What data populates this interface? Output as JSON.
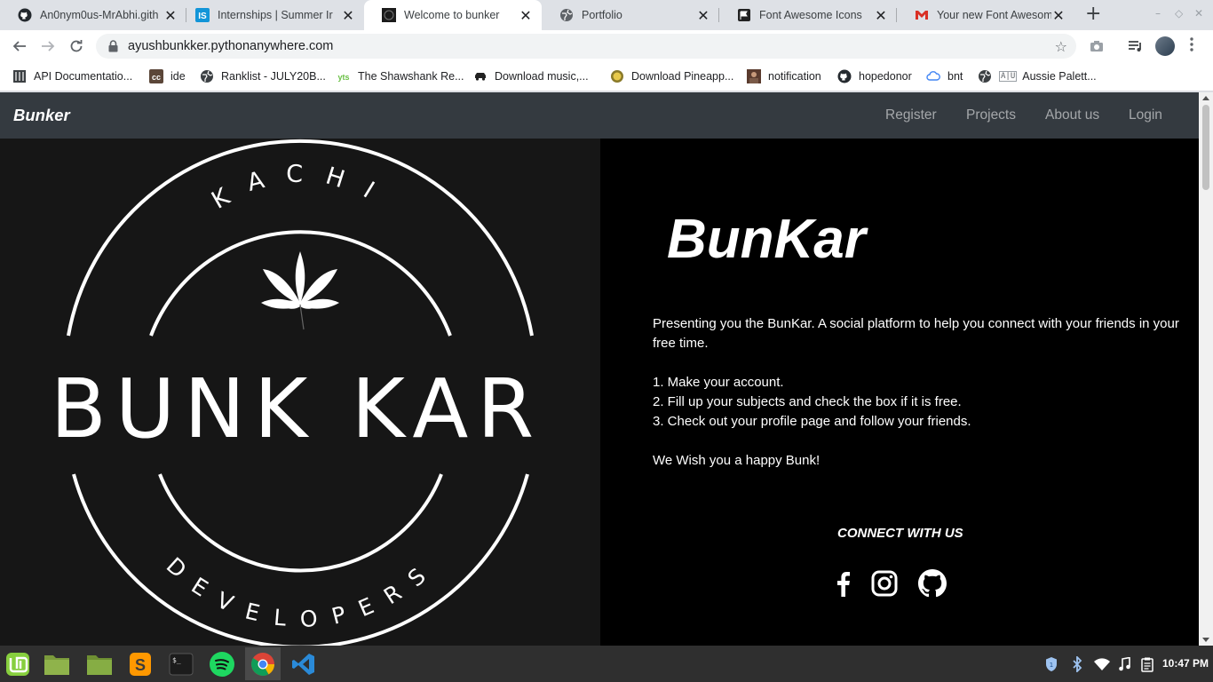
{
  "browser": {
    "tabs": [
      {
        "title": "An0nym0us-MrAbhi.gith",
        "favicon": "github-icon"
      },
      {
        "title": "Internships | Summer Ir",
        "favicon": "internshala-icon"
      },
      {
        "title": "Welcome to bunker",
        "favicon": "bunker-icon",
        "active": true
      },
      {
        "title": "Portfolio",
        "favicon": "globe-icon"
      },
      {
        "title": "Font Awesome Icons",
        "favicon": "flag-icon"
      },
      {
        "title": "Your new Font Awesome",
        "favicon": "gmail-icon"
      }
    ],
    "new_tab": "+",
    "url": "ayushbunkker.pythonanywhere.com",
    "bookmarks": [
      {
        "label": "API Documentatio...",
        "icon": "book-icon"
      },
      {
        "label": "ide",
        "icon": "codechef-icon"
      },
      {
        "label": "Ranklist - JULY20B...",
        "icon": "globe-icon"
      },
      {
        "label": "The Shawshank Re...",
        "icon": "yts-icon"
      },
      {
        "label": "Download music,...",
        "icon": "car-icon"
      },
      {
        "label": "Download Pineapp...",
        "icon": "pineapple-icon"
      },
      {
        "label": "notification",
        "icon": "avatar-icon"
      },
      {
        "label": "hopedonor",
        "icon": "github-icon"
      },
      {
        "label": "bnt",
        "icon": "cloud-icon"
      },
      {
        "label": "Aussie Palett...",
        "icon": "globe-icon"
      }
    ]
  },
  "site": {
    "brand": "Bunker",
    "nav": [
      "Register",
      "Projects",
      "About us",
      "Login"
    ],
    "logo": {
      "arc_top": "KACHI",
      "main": "BUNK KAR",
      "arc_bottom": "DEVELOPERS"
    },
    "hero_title": "BunKar",
    "intro": "Presenting you the BunKar. A social platform to help you connect with your friends in your free time.",
    "steps": [
      "1. Make your account.",
      "2. Fill up your subjects and check the box if it is free.",
      "3. Check out your profile page and follow your friends."
    ],
    "closing": "We Wish you a happy Bunk!",
    "connect_heading": "CONNECT WITH US",
    "social": [
      "facebook-icon",
      "instagram-icon",
      "github-icon"
    ]
  },
  "taskbar": {
    "apps": [
      "mint-menu-icon",
      "folder-icon",
      "files-icon",
      "sublime-icon",
      "terminal-icon",
      "spotify-icon",
      "chrome-icon",
      "vscode-icon"
    ],
    "active_app": "chrome-icon",
    "time": "10:47 PM"
  },
  "colors": {
    "navbar": "#343a40",
    "left_panel": "#161616",
    "right_panel": "#000000",
    "tab_strip": "#dee1e6"
  }
}
